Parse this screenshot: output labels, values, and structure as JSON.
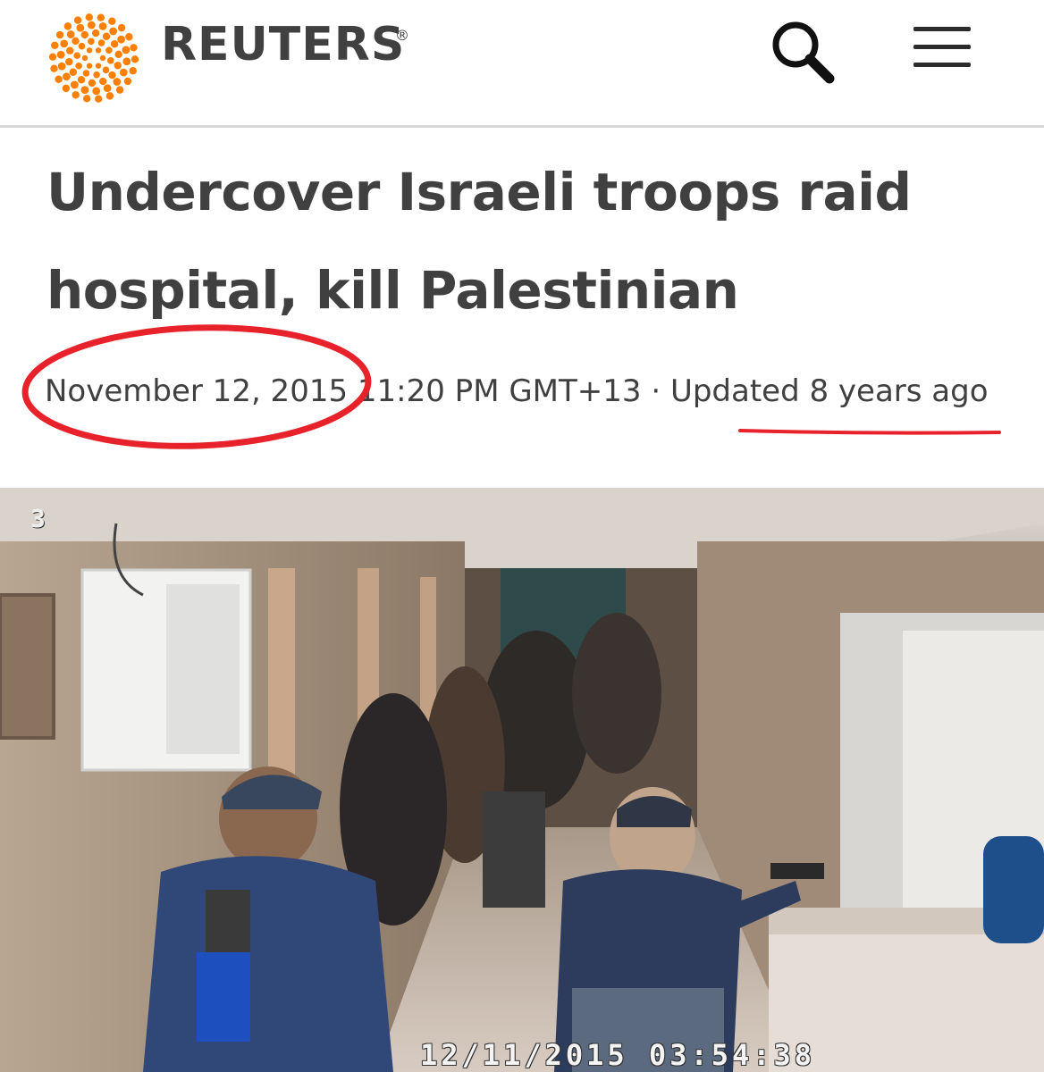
{
  "header": {
    "brand": "REUTERS",
    "registered_mark": "®",
    "logo_icon": "reuters-dot-logo-icon",
    "search_icon": "search-icon",
    "menu_icon": "hamburger-menu-icon",
    "brand_color": "#ff8000",
    "text_color": "#404040"
  },
  "article": {
    "headline": "Undercover Israeli troops raid hospital, kill Palestinian",
    "dateline": "November 12, 2015 11:20 PM GMT+13 · Updated 8 years ago",
    "annotation_color": "#e8222a"
  },
  "photo": {
    "camera_number": "3",
    "timestamp": "12/11/2015 03:54:38"
  }
}
